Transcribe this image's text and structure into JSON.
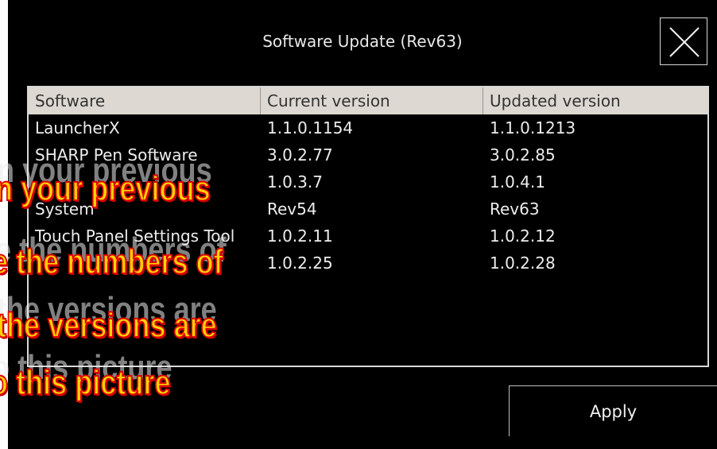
{
  "dialog": {
    "title": "Software Update (Rev63)",
    "close_icon": "close-icon",
    "apply_label": "Apply"
  },
  "table": {
    "headers": [
      "Software",
      "Current version",
      "Updated version"
    ],
    "rows": [
      [
        "LauncherX",
        "1.1.0.1154",
        "1.1.0.1213"
      ],
      [
        "SHARP Pen Software",
        "3.0.2.77",
        "3.0.2.85"
      ],
      [
        "",
        "1.0.3.7",
        "1.0.4.1"
      ],
      [
        "System",
        "Rev54",
        "Rev63"
      ],
      [
        "Touch Panel Settings Tool",
        "1.0.2.11",
        "1.0.2.12"
      ],
      [
        "",
        "1.0.2.25",
        "1.0.2.28"
      ]
    ]
  },
  "overlay_caption": {
    "lines": [
      "n your previous",
      "e the numbers of",
      "the versions are",
      "o this picture"
    ],
    "text_color": "#ffd400",
    "outline_color": "#e00000"
  }
}
